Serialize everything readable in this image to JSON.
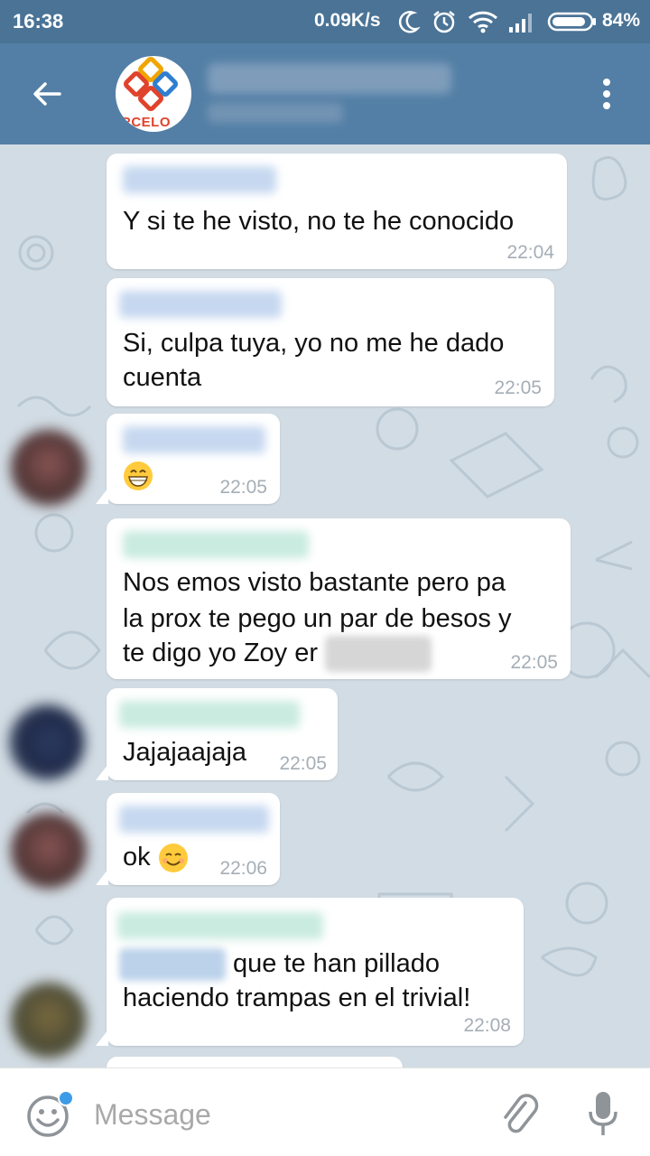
{
  "status_bar": {
    "time": "16:38",
    "network_speed": "0.09K/s",
    "battery": "84%"
  },
  "header": {
    "group_logo_text": "RCELO"
  },
  "messages": [
    {
      "text": "Y si te he visto, no te he conocido",
      "time": "22:04"
    },
    {
      "text_line1": "Si, culpa tuya, yo no me he dado",
      "text_line2": "cuenta",
      "time": "22:05"
    },
    {
      "emoji": "grinning-face",
      "time": "22:05"
    },
    {
      "text_line1": "Nos emos visto bastante pero pa",
      "text_line2": "la prox te pego un par de besos y",
      "text_line3": "te digo yo Zoy er",
      "time": "22:05"
    },
    {
      "text": "Jajajaajaja",
      "time": "22:05"
    },
    {
      "text": "ok",
      "emoji": "smiling-face",
      "time": "22:06"
    },
    {
      "text_line1": "que te han pillado",
      "text_line2": "haciendo trampas en el trivial!",
      "time": "22:08"
    }
  ],
  "input": {
    "placeholder": "Message"
  },
  "colors": {
    "header": "#537fa6",
    "status_bar": "#4a7396",
    "chat_background": "#d2dce4",
    "timestamp": "#a5aeb6"
  }
}
